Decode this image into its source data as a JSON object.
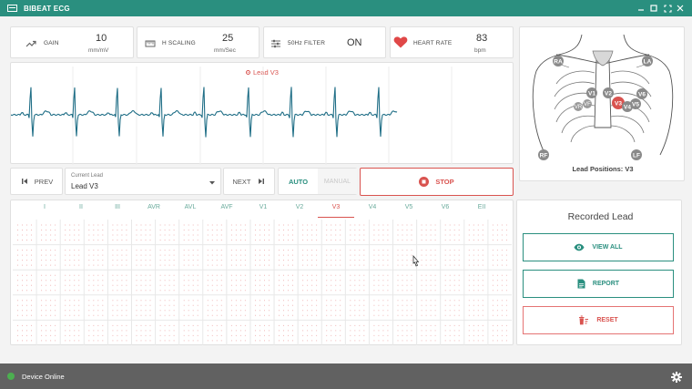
{
  "app": {
    "title": "BIBEAT ECG"
  },
  "stats": {
    "gain": {
      "label": "GAIN",
      "value": "10",
      "unit": "mm/mV"
    },
    "h_scaling": {
      "label": "H SCALING",
      "value": "25",
      "unit": "mm/Sec"
    },
    "filter": {
      "label": "50Hz FILTER",
      "value": "ON"
    },
    "heart_rate": {
      "label": "HEART RATE",
      "value": "83",
      "unit": "bpm"
    }
  },
  "waveform": {
    "lead_title": "Lead V3"
  },
  "body_diagram": {
    "caption": "Lead Positions: V3",
    "labels": [
      "RA",
      "LA",
      "RF",
      "LF",
      "V1",
      "V2",
      "V3",
      "V4",
      "V5",
      "V6"
    ],
    "active": "V3"
  },
  "controls": {
    "prev": "PREV",
    "current_lead_label": "Current Lead",
    "current_lead_value": "Lead V3",
    "next": "NEXT",
    "auto": "AUTO",
    "manual": "MANUAL",
    "stop": "STOP"
  },
  "tabs": [
    "I",
    "II",
    "III",
    "AVR",
    "AVL",
    "AVF",
    "V1",
    "V2",
    "V3",
    "V4",
    "V5",
    "V6",
    "EII"
  ],
  "active_tab": "V3",
  "recorded": {
    "title": "Recorded Lead",
    "view_all": "VIEW ALL",
    "report": "REPORT",
    "reset": "RESET"
  },
  "status": {
    "text": "Device Online"
  },
  "colors": {
    "primary": "#2a8f7f",
    "accent": "#d9534f",
    "statusbar": "#616161",
    "waveform": "#1f6e86"
  }
}
